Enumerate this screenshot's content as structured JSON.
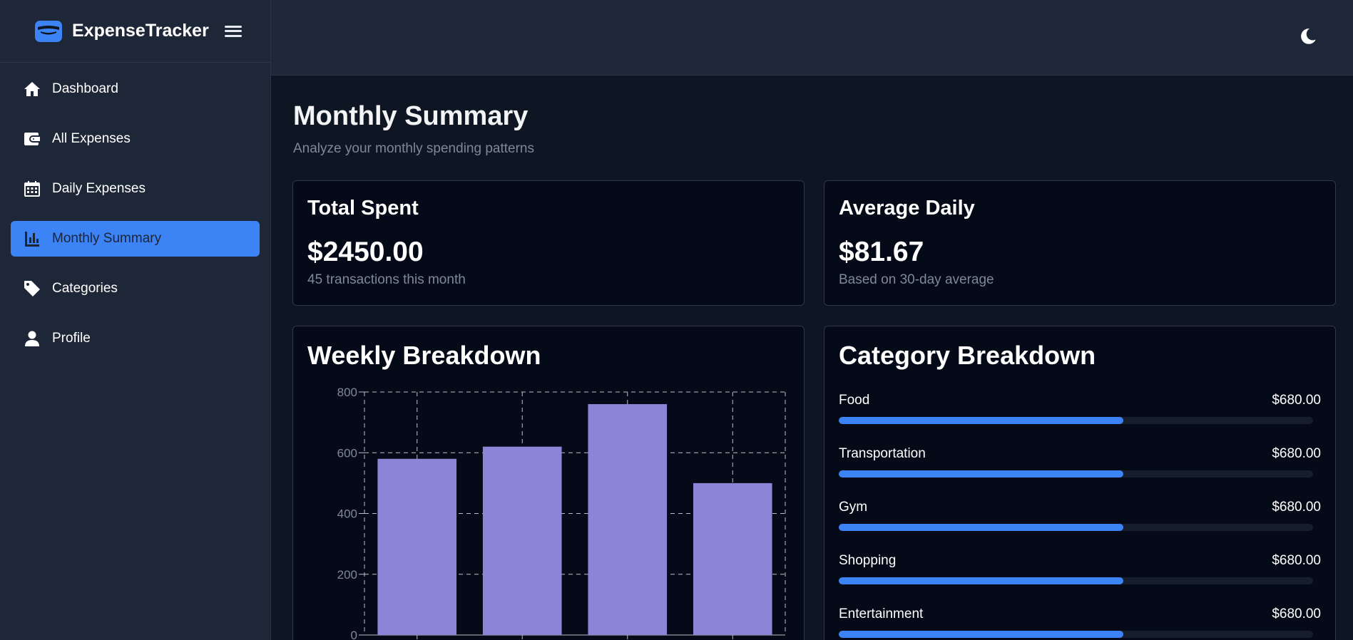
{
  "app": {
    "name": "ExpenseTracker"
  },
  "sidebar": {
    "items": [
      {
        "label": "Dashboard",
        "icon": "home-icon",
        "active": false
      },
      {
        "label": "All Expenses",
        "icon": "wallet-icon",
        "active": false
      },
      {
        "label": "Daily Expenses",
        "icon": "calendar-icon",
        "active": false
      },
      {
        "label": "Monthly Summary",
        "icon": "bar-chart-icon",
        "active": true
      },
      {
        "label": "Categories",
        "icon": "tag-icon",
        "active": false
      },
      {
        "label": "Profile",
        "icon": "user-icon",
        "active": false
      }
    ]
  },
  "topbar": {
    "theme_icon": "moon-icon"
  },
  "page": {
    "title": "Monthly Summary",
    "subtitle": "Analyze your monthly spending patterns"
  },
  "stats": {
    "total": {
      "title": "Total Spent",
      "value": "$2450.00",
      "sub": "45 transactions this month"
    },
    "average": {
      "title": "Average Daily",
      "value": "$81.67",
      "sub": "Based on 30-day average"
    }
  },
  "weekly": {
    "title": "Weekly Breakdown"
  },
  "categories": {
    "title": "Category Breakdown",
    "items": [
      {
        "name": "Food",
        "amount": "$680.00",
        "fraction": 0.6
      },
      {
        "name": "Transportation",
        "amount": "$680.00",
        "fraction": 0.6
      },
      {
        "name": "Gym",
        "amount": "$680.00",
        "fraction": 0.6
      },
      {
        "name": "Shopping",
        "amount": "$680.00",
        "fraction": 0.6
      },
      {
        "name": "Entertainment",
        "amount": "$680.00",
        "fraction": 0.6
      }
    ]
  },
  "colors": {
    "accent": "#3c83f6",
    "bar": "#8b85d8",
    "background": "#0f1623",
    "card": "#050a18"
  },
  "chart_data": {
    "type": "bar",
    "categories": [
      "",
      "",
      "",
      ""
    ],
    "values": [
      580,
      620,
      760,
      500
    ],
    "yticks": [
      "0",
      "200",
      "400",
      "600",
      "800"
    ],
    "ylim": [
      0,
      800
    ],
    "grid": true
  }
}
